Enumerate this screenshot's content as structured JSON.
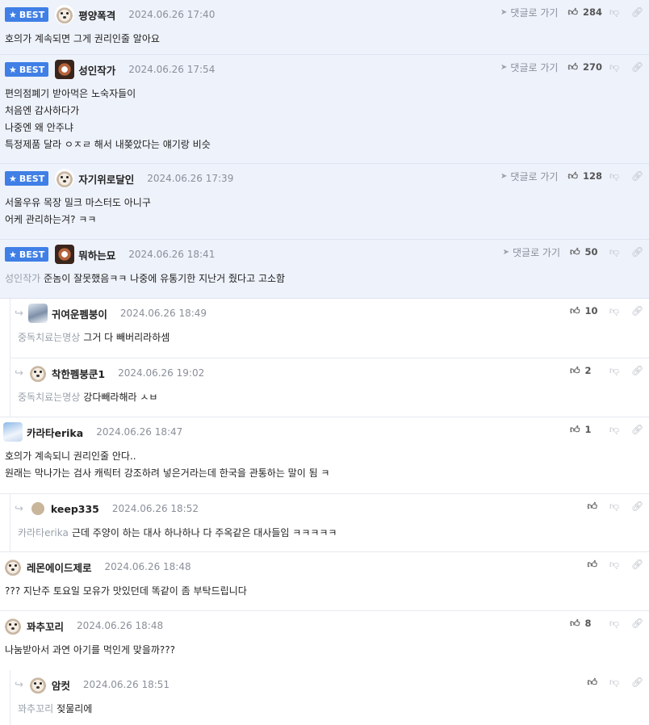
{
  "ui": {
    "best_label": "BEST",
    "best_star": "★",
    "goto_label": "댓글로 가기",
    "goto_icon": "navigation-arrow-icon",
    "reply_arrow": "↪",
    "thumb_up": "👍︎",
    "thumb_down": "👎︎",
    "share": "🔗︎"
  },
  "comments": [
    {
      "best": true,
      "nick": "평양폭격",
      "date": "2024.06.26 17:40",
      "likes": "284",
      "lines": [
        "호의가 계속되면 그게 권리인줄 알아요"
      ]
    },
    {
      "best": true,
      "nick": "성인작가",
      "date": "2024.06.26 17:54",
      "likes": "270",
      "lines": [
        "편의점폐기 받아먹은 노숙자들이",
        "처음엔 감사하다가",
        "나중엔 왜 안주냐",
        "특정제품 달라 ㅇㅈㄹ 해서 내쫒았다는 얘기랑 비슷"
      ]
    },
    {
      "best": true,
      "nick": "자기위로달인",
      "date": "2024.06.26 17:39",
      "likes": "128",
      "lines": [
        "서울우유 목장 밀크 마스터도 아니구",
        "어케 관리하는겨? ㅋㅋ"
      ]
    },
    {
      "best": true,
      "nick": "뭐하는묘",
      "date": "2024.06.26 18:41",
      "likes": "50",
      "mention": "성인작가",
      "lines": [
        "준놈이 잘못했음ㅋㅋ 나중에 유통기한 지난거 줬다고 고소함"
      ]
    },
    {
      "reply": true,
      "nick": "귀여운펨붕이",
      "date": "2024.06.26 18:49",
      "likes": "10",
      "mention": "중독치료는명상",
      "lines": [
        "그거 다 빼버리라하셈"
      ]
    },
    {
      "reply": true,
      "nick": "착한펨붕쿤1",
      "date": "2024.06.26 19:02",
      "likes": "2",
      "mention": "중독치료는명상",
      "lines": [
        "강다빼라해라 ㅅㅂ"
      ]
    },
    {
      "nick": "카라타erika",
      "date": "2024.06.26 18:47",
      "likes": "1",
      "lines": [
        "호의가 계속되니 권리인줄 안다..",
        "원래는 막나가는 검사 캐릭터 강조하려 넣은거라는데 한국을 관통하는 말이 됨 ㅋ"
      ]
    },
    {
      "reply": true,
      "nick": "keep335",
      "date": "2024.06.26 18:52",
      "likes": "",
      "mention": "카라타erika",
      "lines": [
        "근데 주양이 하는 대사 하나하나 다 주옥같은 대사들임 ㅋㅋㅋㅋㅋ"
      ]
    },
    {
      "nick": "레몬에이드제로",
      "date": "2024.06.26 18:48",
      "likes": "",
      "lines": [
        "??? 지난주 토요일 모유가 맛있던데 똑같이 좀 부탁드립니다"
      ]
    },
    {
      "nick": "꽈추꼬리",
      "date": "2024.06.26 18:48",
      "likes": "8",
      "lines": [
        "나눔받아서 과연 아기를 먹인게 맞을까???"
      ]
    },
    {
      "reply": true,
      "nick": "암컷",
      "date": "2024.06.26 18:51",
      "likes": "",
      "mention": "꽈추꼬리",
      "lines": [
        "젖물리에"
      ]
    }
  ]
}
